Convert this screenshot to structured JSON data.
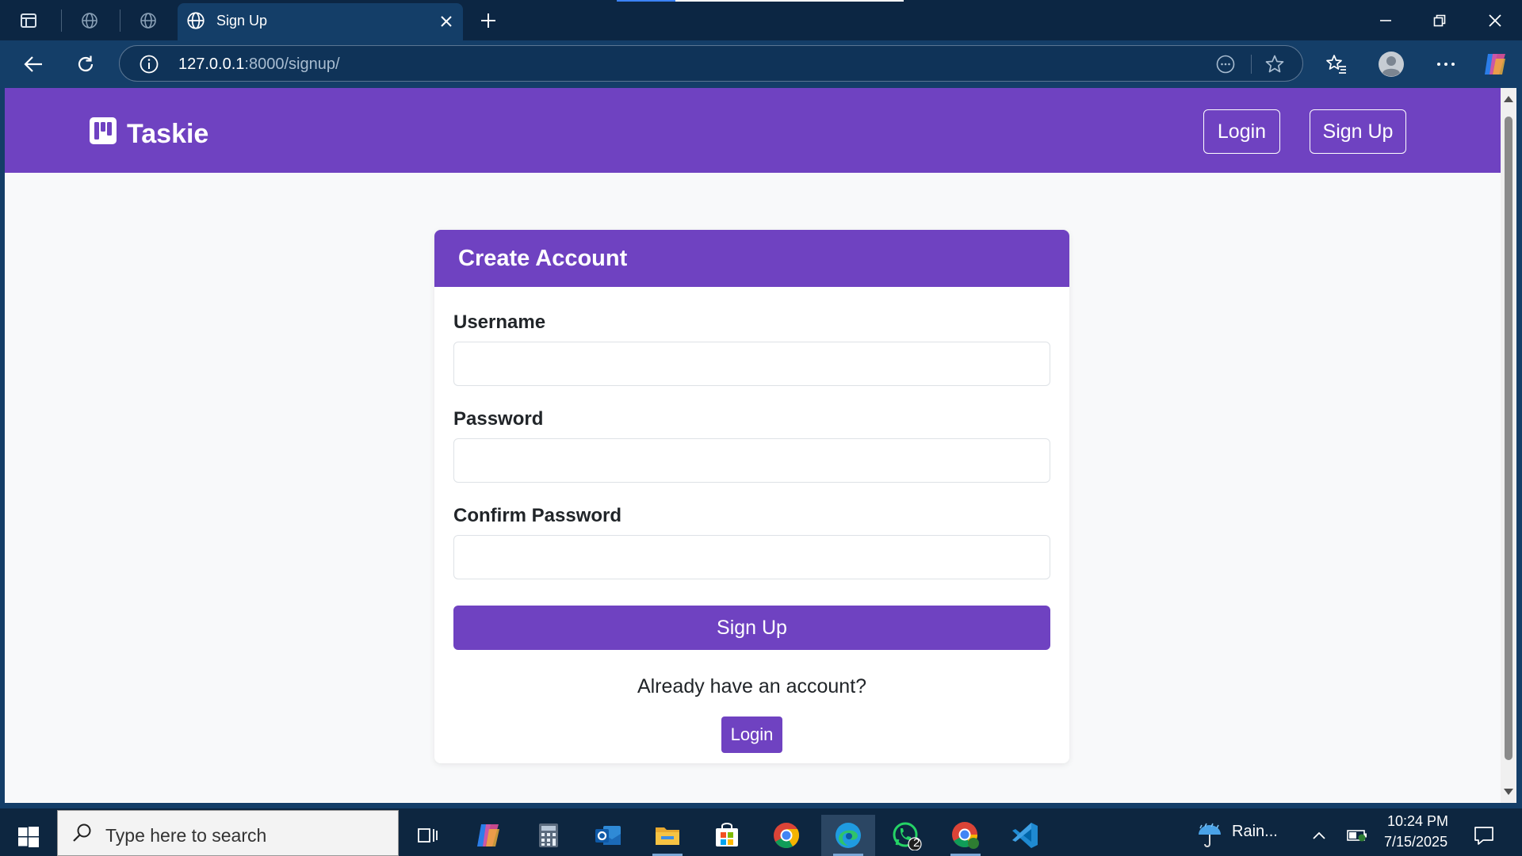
{
  "browser": {
    "tab_title": "Sign Up",
    "url_host": "127.0.0.1",
    "url_path": ":8000/signup/"
  },
  "site": {
    "brand": "Taskie",
    "nav": {
      "login": "Login",
      "signup": "Sign Up"
    }
  },
  "form": {
    "title": "Create Account",
    "username_label": "Username",
    "password_label": "Password",
    "confirm_label": "Confirm Password",
    "username_value": "",
    "password_value": "",
    "confirm_value": "",
    "submit_label": "Sign Up",
    "already_text": "Already have an account?",
    "login_label": "Login"
  },
  "taskbar": {
    "search_placeholder": "Type here to search",
    "weather": "Rain...",
    "time": "10:24 PM",
    "date": "7/15/2025",
    "whatsapp_badge": "2"
  },
  "colors": {
    "accent": "#6f42c1",
    "chrome_dark": "#0c2643",
    "chrome": "#143e68"
  }
}
